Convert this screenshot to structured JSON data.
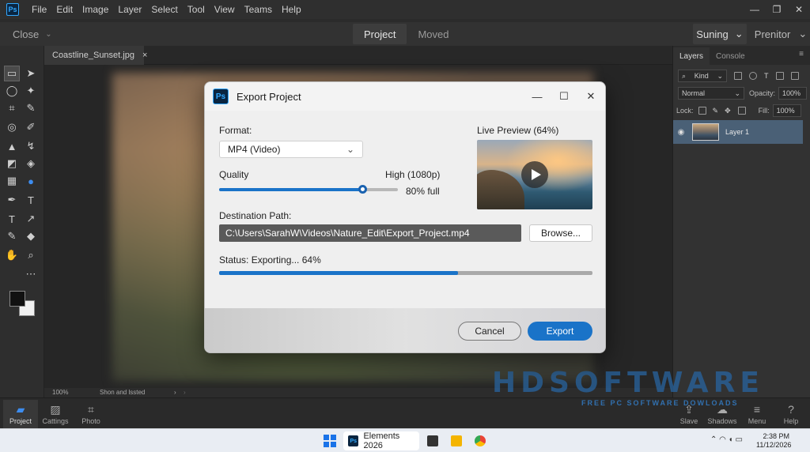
{
  "app": {
    "logo": "Ps",
    "menu": [
      "File",
      "Edit",
      "Image",
      "Layer",
      "Select",
      "Tool",
      "View",
      "Teams",
      "Help"
    ],
    "window_controls": [
      "—",
      "❐",
      "✕"
    ]
  },
  "optionsbar": {
    "close_label": "Close",
    "tabs": [
      "Project",
      "Moved"
    ],
    "active_tab": "Project",
    "workspace_label": "Suning",
    "premier_label": "Prenitor"
  },
  "document": {
    "tab_name": "Coastline_Sunset.jpg",
    "tab_close": "×",
    "status_zoom": "100%",
    "status_info": "Shon and lssted"
  },
  "panel": {
    "tabs": [
      "Layers",
      "Console"
    ],
    "kind_label": "Kind",
    "blend_mode": "Normal",
    "opacity_label": "Opacity:",
    "opacity_value": "100%",
    "lock_label": "Lock:",
    "fill_label": "Fill:",
    "fill_value": "100%",
    "layer_name": "Layer 1"
  },
  "dialog": {
    "title": "Export Project",
    "format_label": "Format:",
    "format_value": "MP4 (Video)",
    "quality_label": "Quality",
    "quality_value": "High (1080p)",
    "quality_percent_text": "80% full",
    "quality_fraction": 0.8,
    "preview_label": "Live Preview (64%)",
    "destination_label": "Destination Path:",
    "destination_value": "C:\\Users\\SarahW\\Videos\\Nature_Edit\\Export_Project.mp4",
    "browse_label": "Browse...",
    "status_text": "Status: Exporting... 64%",
    "progress_fraction": 0.64,
    "cancel_label": "Cancel",
    "export_label": "Export"
  },
  "bottombar": {
    "left_items": [
      "Project",
      "Cattings",
      "Photo"
    ],
    "right_items": [
      "Slave",
      "Shadows",
      "Menu",
      "Help"
    ]
  },
  "watermark": {
    "big": "HDSOFTWARE",
    "small": "FREE PC SOFTWARE DOWLOADS"
  },
  "taskbar": {
    "app_label": "Elements 2026",
    "app_logo": "Ps",
    "time": "2:38 PM",
    "date": "11/12/2026"
  },
  "colors": {
    "accent": "#1a73c8",
    "ps_blue": "#31a8ff",
    "app_bg": "#2b2b2b"
  }
}
